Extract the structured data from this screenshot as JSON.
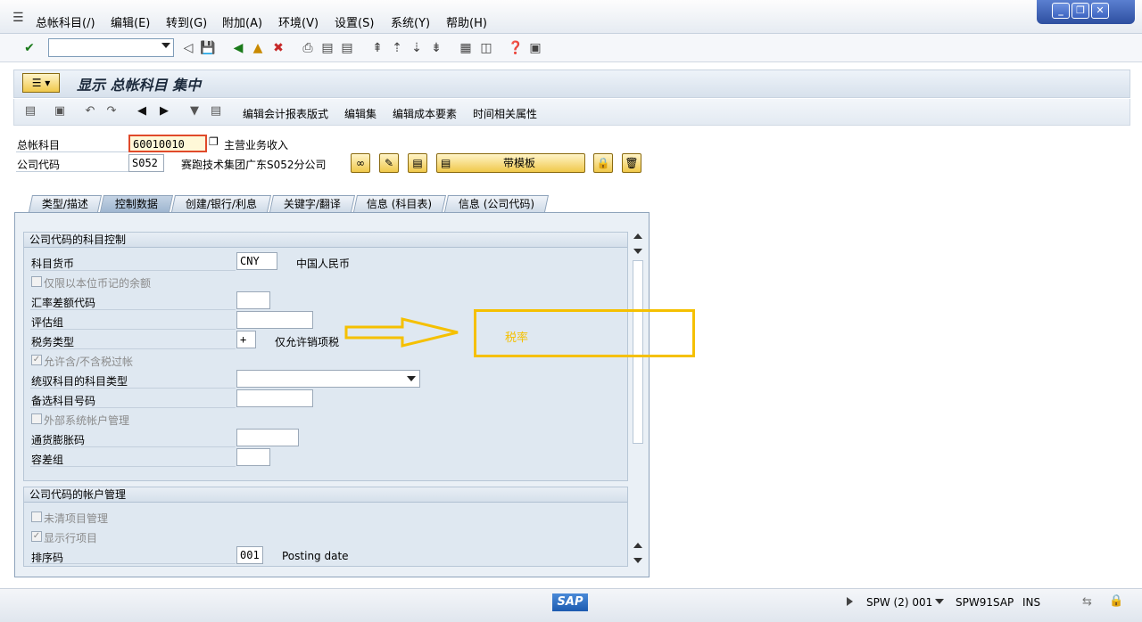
{
  "menu": {
    "items": [
      "总帐科目(/)",
      "编辑(E)",
      "转到(G)",
      "附加(A)",
      "环境(V)",
      "设置(S)",
      "系统(Y)",
      "帮助(H)"
    ]
  },
  "title": "显示 总帐科目 集中",
  "appbar": {
    "btn_layout": "编辑会计报表版式",
    "btn_set": "编辑集",
    "btn_cost": "编辑成本要素",
    "btn_time": "时间相关属性"
  },
  "header": {
    "gl_label": "总帐科目",
    "gl_value": "60010010",
    "gl_desc": "主营业务收入",
    "cc_label": "公司代码",
    "cc_value": "S052",
    "cc_desc": "赛跑技术集团广东S052分公司",
    "template_btn": "带模板"
  },
  "tabs": [
    "类型/描述",
    "控制数据",
    "创建/银行/利息",
    "关键字/翻译",
    "信息 (科目表)",
    "信息 (公司代码)"
  ],
  "group1": {
    "title": "公司代码的科目控制",
    "currency_label": "科目货币",
    "currency_value": "CNY",
    "currency_desc": "中国人民币",
    "local_only_label": "仅限以本位币记的余额",
    "exch_diff_label": "汇率差额代码",
    "valuation_label": "评估组",
    "tax_cat_label": "税务类型",
    "tax_cat_value": "+",
    "tax_cat_desc": "仅允许销项税",
    "no_tax_label": "允许含/不含税过帐",
    "recon_label": "统驭科目的科目类型",
    "alt_acct_label": "备选科目号码",
    "ext_mgmt_label": "外部系统帐户管理",
    "inflation_label": "通货膨胀码",
    "tolerance_label": "容差组"
  },
  "group2": {
    "title": "公司代码的帐户管理",
    "open_item_label": "未清项目管理",
    "line_item_label": "显示行项目",
    "sort_label": "排序码",
    "sort_value": "001",
    "sort_desc": "Posting date"
  },
  "annotation": {
    "text": "税率"
  },
  "status": {
    "system": "SPW (2) 001",
    "server": "SPW91SAP",
    "mode": "INS"
  },
  "colors": {
    "annotation": "#f5c000",
    "panel": "#eaf0f6"
  }
}
